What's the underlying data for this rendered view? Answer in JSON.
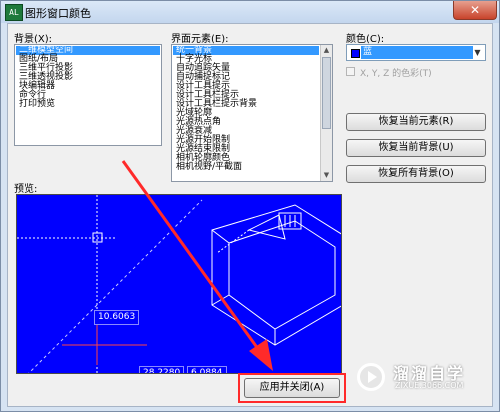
{
  "window": {
    "title": "图形窗口颜色",
    "app_icon_text": "AL",
    "close_icon": "close-icon",
    "close_glyph": "✕"
  },
  "context_list": {
    "label": "背景(X):",
    "items": [
      "二维模型空间",
      "图纸/布局",
      "三维平行投影",
      "三维透视投影",
      "块编辑器",
      "命令行",
      "打印预览"
    ],
    "selected": 0
  },
  "element_list": {
    "label": "界面元素(E):",
    "items": [
      "统一背景",
      "十字光标",
      "自动追踪矢量",
      "自动捕捉标记",
      "设计工具提示",
      "设计工具栏提示",
      "设计工具栏提示背景",
      "光域轮廓",
      "光源热点角",
      "光源衰减",
      "光源开始限制",
      "光源结束限制",
      "相机轮廓颜色",
      "相机视野/平截面"
    ],
    "selected": 0,
    "scroll_up_glyph": "▲",
    "scroll_down_glyph": "▼"
  },
  "color": {
    "label": "颜色(C):",
    "value": "蓝",
    "swatch_color": "#0000ff",
    "dropdown_glyph": "▼",
    "tint_label": "X, Y, Z 的色彩(T)",
    "tint_checked": false
  },
  "buttons": {
    "restore_element": "恢复当前元素(R)",
    "restore_context": "恢复当前背景(U)",
    "restore_all": "恢复所有背景(O)",
    "apply_close": "应用并关闭(A)"
  },
  "preview": {
    "label": "预览:",
    "background": "#0000ff",
    "coord_1": "10.6063",
    "coord_2": "28.2280",
    "coord_3": "6.0884"
  },
  "annotation": {
    "arrow_color": "#ff2a2a",
    "highlight_color": "#ff2a2a"
  },
  "watermark": {
    "brand": "溜溜自学",
    "url": "ZIXUE.3066.COM"
  }
}
